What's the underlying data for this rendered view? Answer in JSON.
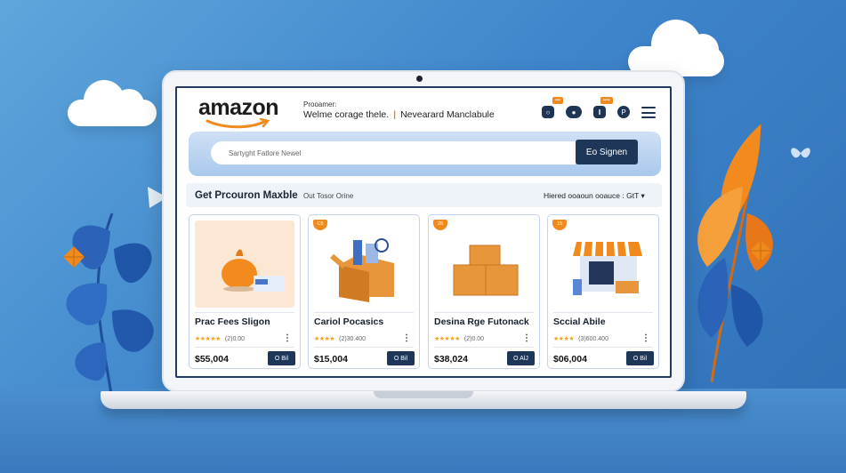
{
  "header": {
    "logo_text": "amazon",
    "promo_label": "Prooamer:",
    "promo_text_1": "Welme corage thele.",
    "promo_text_2": "Nevearard Manclabule",
    "badges": [
      "•••",
      "••••"
    ]
  },
  "search": {
    "placeholder": "Sartyght Fatlore Newel",
    "button_label": "Eo Signen"
  },
  "section": {
    "title": "Get Prcouron Maxble",
    "subtitle": "Out Tosor Orine",
    "right_text": "Hiered ooaoun ooauce : GtT"
  },
  "products": [
    {
      "title": "Prac Fees Sligon",
      "rating_meta": "(2)0.00",
      "price": "$55,004",
      "button": "O Bil",
      "badge": ""
    },
    {
      "title": "Cariol Pocasics",
      "rating_meta": "(2)30.400",
      "price": "$15,004",
      "button": "O Bil",
      "badge": "C5"
    },
    {
      "title": "Desina Rge Futonack",
      "rating_meta": "(2)0.00",
      "price": "$38,024",
      "button": "O AlJ",
      "badge": "25"
    },
    {
      "title": "Sccial Abile",
      "rating_meta": "(3)600.400",
      "price": "$06,004",
      "button": "O Bil",
      "badge": "15"
    }
  ],
  "colors": {
    "brand_orange": "#f08a1c",
    "navy": "#1e3657",
    "background_blue": "#3f86cc"
  },
  "icons": [
    "chat-icon",
    "toggle-icon",
    "user-icon",
    "profile-icon",
    "menu-icon",
    "star-icon",
    "kebab-icon"
  ]
}
